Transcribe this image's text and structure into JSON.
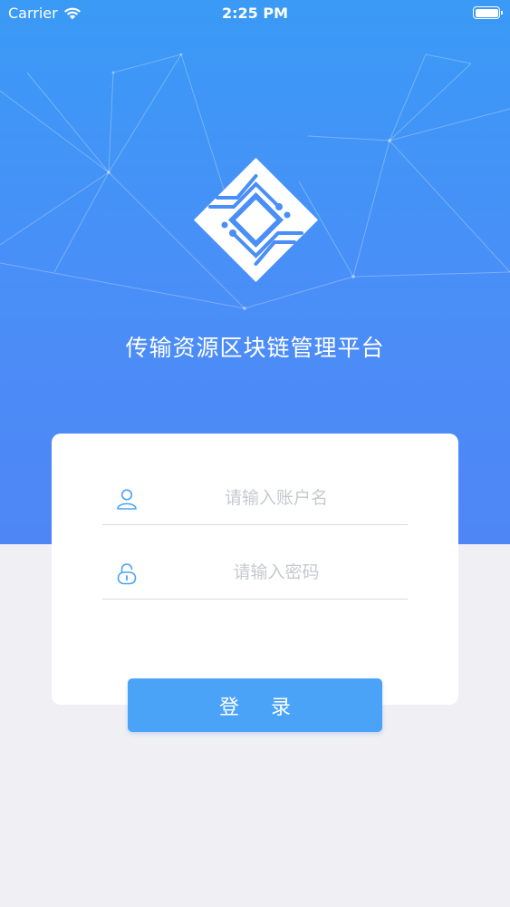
{
  "status_bar": {
    "carrier": "Carrier",
    "time": "2:25 PM",
    "wifi_icon": "wifi-icon",
    "battery_icon": "battery-icon"
  },
  "app": {
    "title": "传输资源区块链管理平台",
    "logo_icon": "circuit-diamond-logo"
  },
  "login_form": {
    "username": {
      "icon": "user-icon",
      "value": "",
      "placeholder": "请输入账户名"
    },
    "password": {
      "icon": "lock-icon",
      "value": "",
      "placeholder": "请输入密码"
    },
    "submit_label": "登 录"
  },
  "colors": {
    "hero_top": "#3a9af6",
    "hero_bottom": "#4f86f6",
    "button": "#4aa3f7",
    "icon": "#4aa3f7",
    "background": "#efeff4",
    "placeholder": "#c6c9cf"
  }
}
